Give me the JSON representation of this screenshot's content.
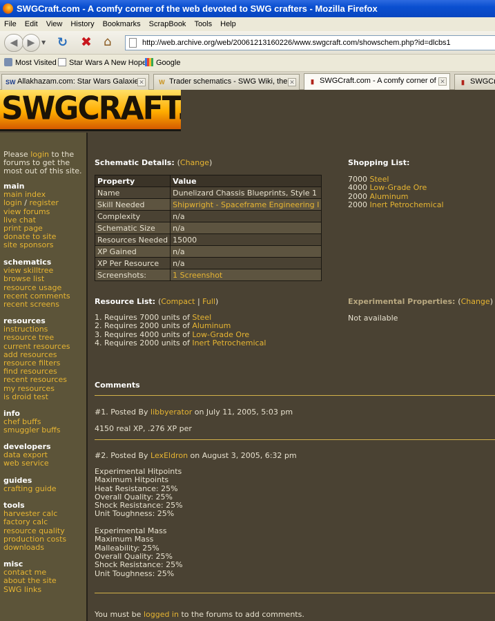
{
  "browser": {
    "title": "SWGCraft.com - A comfy corner of the web devoted to SWG crafters - Mozilla Firefox",
    "menu": [
      "File",
      "Edit",
      "View",
      "History",
      "Bookmarks",
      "ScrapBook",
      "Tools",
      "Help"
    ],
    "url": "http://web.archive.org/web/20061213160226/www.swgcraft.com/showschem.php?id=dlcbs1",
    "bookmarks": [
      "Most Visited",
      "Star Wars A New Hope",
      "Google"
    ],
    "tabs": [
      {
        "icon": "SW",
        "label": "Allakhazam.com: Star Wars Galaxies",
        "active": false
      },
      {
        "icon": "W",
        "label": "Trader schematics - SWG Wiki, the ...",
        "active": false
      },
      {
        "icon": "▮",
        "label": "SWGCraft.com - A comfy corner of ...",
        "active": true
      },
      {
        "icon": "▮",
        "label": "SWGCraft",
        "active": false
      }
    ],
    "colors": {
      "titlebar": "#0a4fd0",
      "chrome": "#ece9d8"
    }
  },
  "site": {
    "logo_text": "SWGCRAFT.COM",
    "colors": {
      "background": "#4a4233",
      "sidebar": "#5c5439",
      "link": "#e7b532",
      "rule": "#d4b24a"
    }
  },
  "sidebar": {
    "intro_before": "Please",
    "intro_link": "login",
    "intro_after": "to the forums to get the most out of this site.",
    "sections": [
      {
        "heading": "main",
        "items": [
          "main index",
          "login",
          "register",
          "view forums",
          "live chat",
          "print page",
          "donate to site",
          "site sponsors"
        ]
      },
      {
        "heading": "schematics",
        "items": [
          "view skilltree",
          "browse list",
          "resource usage",
          "recent comments",
          "recent screens"
        ]
      },
      {
        "heading": "resources",
        "items": [
          "instructions",
          "resource tree",
          "current resources",
          "add resources",
          "resource filters",
          "find resources",
          "recent resources",
          "my resources",
          "is droid test"
        ]
      },
      {
        "heading": "info",
        "items": [
          "chef buffs",
          "smuggler buffs"
        ]
      },
      {
        "heading": "developers",
        "items": [
          "data export",
          "web service"
        ]
      },
      {
        "heading": "guides",
        "items": [
          "crafting guide"
        ]
      },
      {
        "heading": "tools",
        "items": [
          "harvester calc",
          "factory calc",
          "resource quality",
          "production costs",
          "downloads"
        ]
      },
      {
        "heading": "misc",
        "items": [
          "contact me",
          "about the site",
          "SWG links"
        ]
      }
    ]
  },
  "schematic": {
    "heading": "Schematic Details:",
    "change": "Change",
    "header": [
      "Property",
      "Value"
    ],
    "rows": [
      {
        "label": "Name",
        "value": "Dunelizard Chassis Blueprints, Style 1",
        "link": false
      },
      {
        "label": "Skill Needed",
        "value": "Shipwright - Spaceframe Engineering I",
        "link": true
      },
      {
        "label": "Complexity",
        "value": "n/a",
        "link": false
      },
      {
        "label": "Schematic Size",
        "value": "n/a",
        "link": false
      },
      {
        "label": "Resources Needed",
        "value": "15000",
        "link": false
      },
      {
        "label": "XP Gained",
        "value": "n/a",
        "link": false
      },
      {
        "label": "XP Per Resource",
        "value": "n/a",
        "link": false
      },
      {
        "label": "Screenshots:",
        "value": "1 Screenshot",
        "link": true
      }
    ]
  },
  "shopping": {
    "heading": "Shopping List:",
    "items": [
      {
        "qty": "7000",
        "name": "Steel"
      },
      {
        "qty": "4000",
        "name": "Low-Grade Ore"
      },
      {
        "qty": "2000",
        "name": "Aluminum"
      },
      {
        "qty": "2000",
        "name": "Inert Petrochemical"
      }
    ]
  },
  "resources": {
    "heading": "Resource List:",
    "compact": "Compact",
    "sep": "|",
    "full": "Full",
    "items": [
      {
        "num": "1.",
        "prefix": "Requires 7000 units of",
        "name": "Steel"
      },
      {
        "num": "2.",
        "prefix": "Requires 2000 units of",
        "name": "Aluminum"
      },
      {
        "num": "3.",
        "prefix": "Requires 4000 units of",
        "name": "Low-Grade Ore"
      },
      {
        "num": "4.",
        "prefix": "Requires 2000 units of",
        "name": "Inert Petrochemical"
      }
    ]
  },
  "experimental": {
    "heading": "Experimental Properties:",
    "change": "Change",
    "value": "Not available"
  },
  "comments": {
    "heading": "Comments",
    "entries": [
      {
        "num": "#1.",
        "posted_by": "Posted By",
        "author": "libbyerator",
        "date": "on July 11, 2005, 5:03 pm",
        "lines": [
          "4150 real XP, .276 XP per"
        ]
      },
      {
        "num": "#2.",
        "posted_by": "Posted By",
        "author": "LexEldron",
        "date": "on August 3, 2005, 6:32 pm",
        "lines": [
          "Experimental Hitpoints",
          "Maximum Hitpoints",
          "Heat Resistance: 25%",
          "Overall Quality: 25%",
          "Shock Resistance: 25%",
          "Unit Toughness: 25%",
          "",
          "Experimental Mass",
          "Maximum Mass",
          "Malleability: 25%",
          "Overall Quality: 25%",
          "Shock Resistance: 25%",
          "Unit Toughness: 25%"
        ]
      }
    ],
    "footer_before": "You must be",
    "footer_link": "logged in",
    "footer_after": "to the forums to add comments."
  }
}
